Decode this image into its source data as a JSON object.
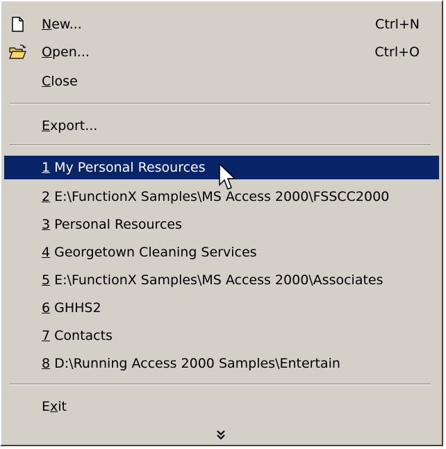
{
  "menu": {
    "items": [
      {
        "mnemonic": "N",
        "rest": "ew...",
        "shortcut": "Ctrl+N",
        "icon": "new-document-icon"
      },
      {
        "mnemonic": "O",
        "rest": "pen...",
        "shortcut": "Ctrl+O",
        "icon": "open-folder-icon"
      },
      {
        "mnemonic": "C",
        "rest": "lose"
      },
      {
        "mnemonic": "E",
        "rest": "xport..."
      }
    ],
    "recent": [
      {
        "num": "1",
        "text": " My Personal Resources"
      },
      {
        "num": "2",
        "text": " E:\\FunctionX Samples\\MS Access 2000\\FSSCC2000"
      },
      {
        "num": "3",
        "text": " Personal Resources"
      },
      {
        "num": "4",
        "text": " Georgetown Cleaning Services"
      },
      {
        "num": "5",
        "text": " E:\\FunctionX Samples\\MS Access 2000\\Associates"
      },
      {
        "num": "6",
        "text": " GHHS2"
      },
      {
        "num": "7",
        "text": " Contacts"
      },
      {
        "num": "8",
        "text": " D:\\Running Access 2000 Samples\\Entertain"
      }
    ],
    "exit": {
      "pre": "E",
      "mnemonic": "x",
      "post": "it"
    },
    "expand_icon": "double-chevron-down-icon",
    "highlight_color": "#0a246a",
    "background_color": "#d4d0c8"
  }
}
